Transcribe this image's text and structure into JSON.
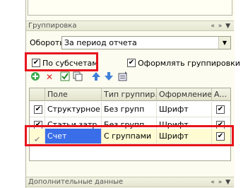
{
  "grouping": {
    "title": "Группировка",
    "controls": "« » ▼"
  },
  "turnover": {
    "label": "Обороты:",
    "value": "За период отчета",
    "dropdown_icon": "chevron-down-icon"
  },
  "checks": {
    "by_subaccounts": {
      "label": "По субсчетам",
      "checked": "✔"
    },
    "format_groupings": {
      "label": "Оформлять группировки",
      "checked": "✔"
    }
  },
  "toolbar": {
    "add_icon": "add-icon",
    "delete_icon": "delete-icon",
    "check_all_icon": "check-all-icon",
    "copy_icon": "copy-icon",
    "up_icon": "arrow-up-icon",
    "down_icon": "arrow-down-icon",
    "settings_icon": "settings-icon"
  },
  "table": {
    "columns": [
      "Поле",
      "Тип группир...",
      "Оформление",
      "А..."
    ],
    "rows": [
      {
        "mark": "✔",
        "field": "Структурное...",
        "type": "Без групп",
        "format": "Шрифт",
        "a": "✔"
      },
      {
        "mark": "✔",
        "field": "Статьи затр...",
        "type": "Без групп",
        "format": "Шрифт",
        "a": "✔"
      },
      {
        "mark": "✔",
        "field": "Счет",
        "type": "С группами",
        "format": "Шрифт",
        "a": "✔"
      }
    ]
  },
  "additional": {
    "title": "Дополнительные данные",
    "controls": "« » ▼"
  },
  "colors": {
    "highlight": "#e8141c",
    "selection": "#3a6ee8"
  }
}
